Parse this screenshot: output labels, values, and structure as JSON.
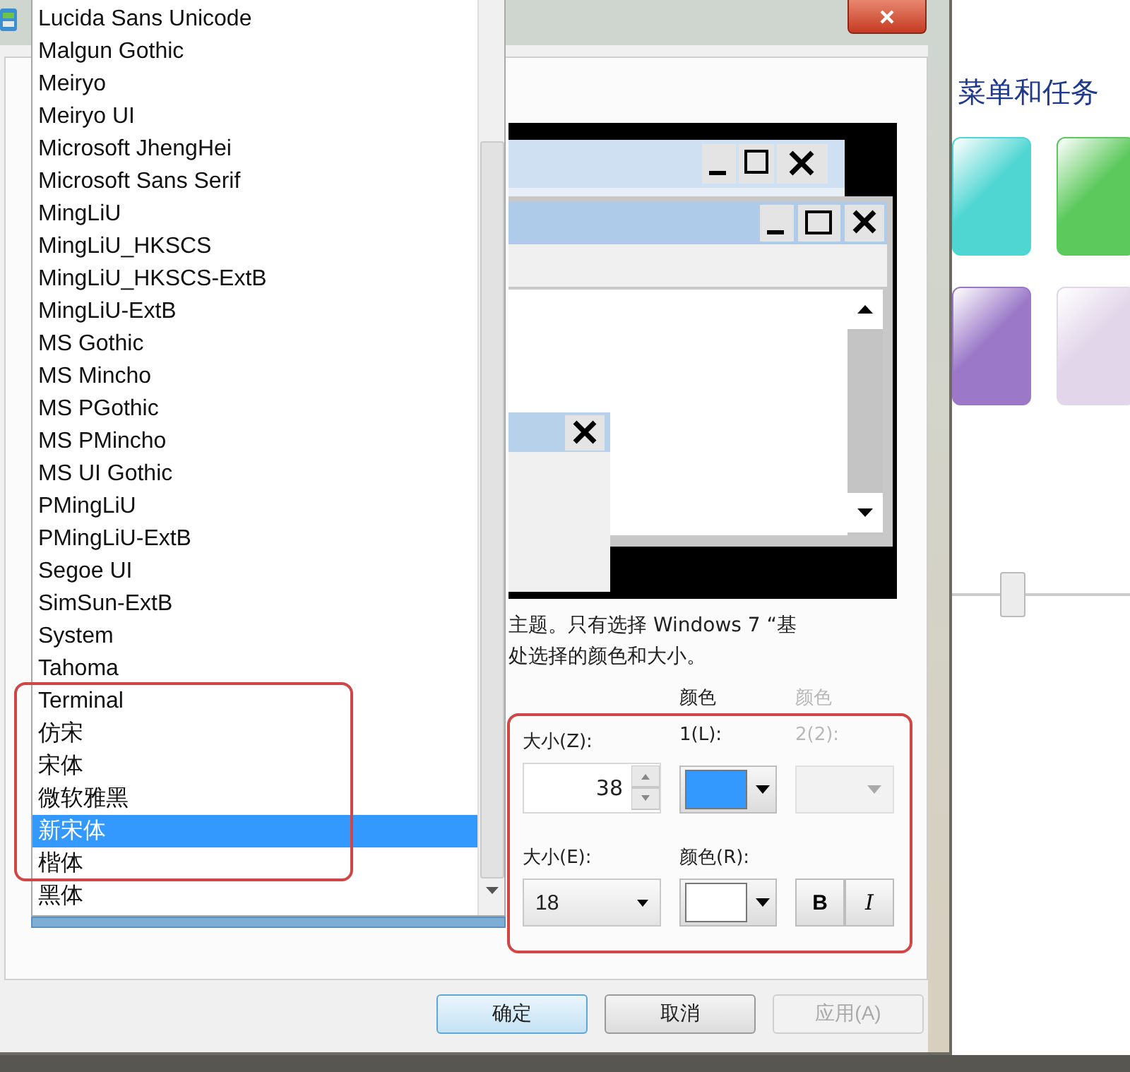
{
  "dialog": {
    "font_list": {
      "highlighted": true,
      "items": [
        {
          "label": "Lucida Sans Unicode",
          "selected": false
        },
        {
          "label": "Malgun Gothic",
          "selected": false
        },
        {
          "label": "Meiryo",
          "selected": false
        },
        {
          "label": "Meiryo UI",
          "selected": false
        },
        {
          "label": "Microsoft JhengHei",
          "selected": false
        },
        {
          "label": "Microsoft Sans Serif",
          "selected": false
        },
        {
          "label": "MingLiU",
          "selected": false
        },
        {
          "label": "MingLiU_HKSCS",
          "selected": false
        },
        {
          "label": "MingLiU_HKSCS-ExtB",
          "selected": false
        },
        {
          "label": "MingLiU-ExtB",
          "selected": false
        },
        {
          "label": "MS Gothic",
          "selected": false
        },
        {
          "label": "MS Mincho",
          "selected": false
        },
        {
          "label": "MS PGothic",
          "selected": false
        },
        {
          "label": "MS PMincho",
          "selected": false
        },
        {
          "label": "MS UI Gothic",
          "selected": false
        },
        {
          "label": "PMingLiU",
          "selected": false
        },
        {
          "label": "PMingLiU-ExtB",
          "selected": false
        },
        {
          "label": "Segoe UI",
          "selected": false
        },
        {
          "label": "SimSun-ExtB",
          "selected": false
        },
        {
          "label": "System",
          "selected": false
        },
        {
          "label": "Tahoma",
          "selected": false
        },
        {
          "label": "Terminal",
          "selected": false
        },
        {
          "label": "仿宋",
          "selected": false
        },
        {
          "label": "宋体",
          "selected": false
        },
        {
          "label": "微软雅黑",
          "selected": false
        },
        {
          "label": "新宋体",
          "selected": true
        },
        {
          "label": "楷体",
          "selected": false
        },
        {
          "label": "黑体",
          "selected": false
        }
      ]
    },
    "description": [
      "主题。只有选择 Windows 7 “基",
      "处选择的颜色和大小。"
    ],
    "item_settings": {
      "highlighted": true,
      "size_label": "大小(Z):",
      "size_value": "38",
      "color1_label": "颜色 1(L):",
      "color2_label": "颜色 2(2):",
      "color2_disabled": true,
      "font_size_label": "大小(E):",
      "font_size_value": "18",
      "font_color_label": "颜色(R):",
      "bold_label": "B",
      "italic_label": "I"
    },
    "buttons": [
      {
        "label": "确定",
        "kind": "default"
      },
      {
        "label": "取消",
        "kind": "normal"
      },
      {
        "label": "应用(A)",
        "kind": "disabled"
      }
    ]
  },
  "background_window": {
    "heading": "菜单和任务",
    "swatches": [
      {
        "color": "#4fd6d3"
      },
      {
        "color": "#5cc95c"
      },
      {
        "color": "#9b78c8"
      },
      {
        "color": "#e2d6ea"
      }
    ],
    "slider": {
      "level": 0.35
    }
  }
}
